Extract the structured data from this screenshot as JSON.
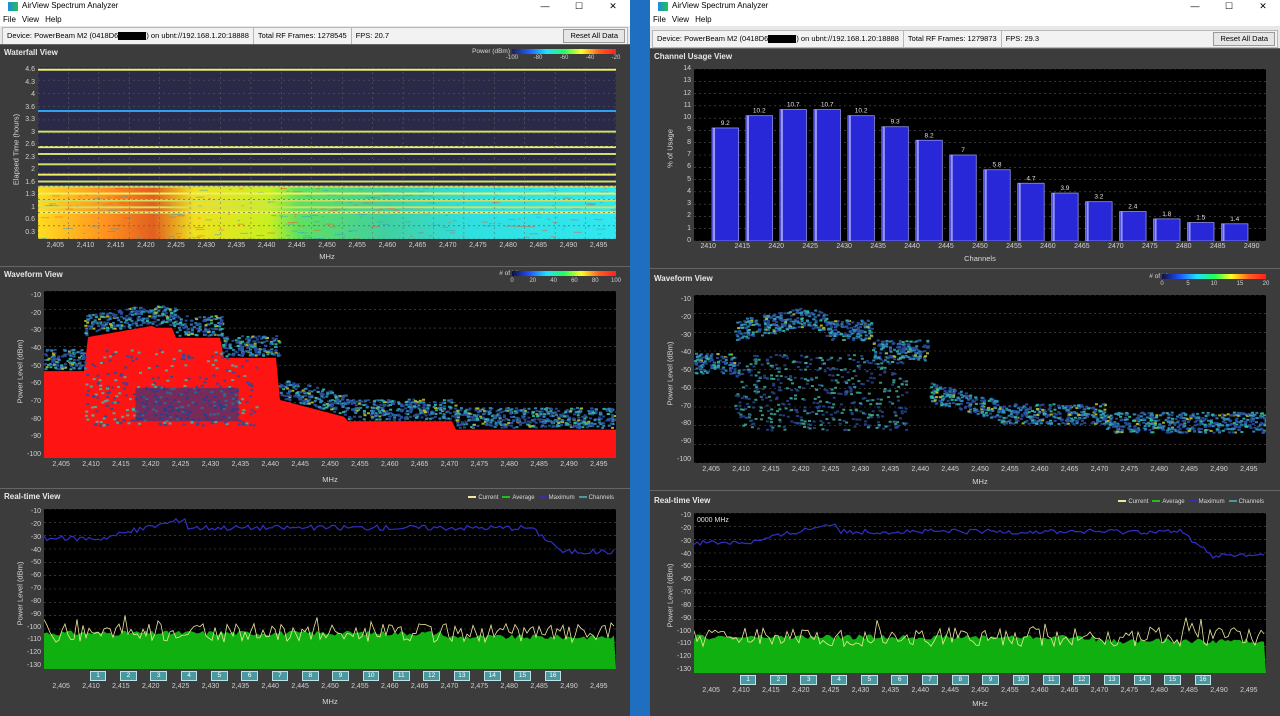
{
  "left": {
    "title": "AirView Spectrum Analyzer",
    "menu": [
      "File",
      "View",
      "Help"
    ],
    "device_prefix": "Device: PowerBeam M2 (0418D6",
    "device_suffix": ") on ubnt://192.168.1.20:18888",
    "rf_frames": "Total RF Frames: 1278545",
    "fps": "FPS: 20.7",
    "reset": "Reset All Data",
    "waterfall": {
      "title": "Waterfall View",
      "ylabel": "Elapsed Time (hours)",
      "xlabel": "MHz",
      "yticks": [
        "4.6",
        "4.3",
        "4",
        "3.6",
        "3.3",
        "3",
        "2.6",
        "2.3",
        "2",
        "1.6",
        "1.3",
        "1",
        "0.6",
        "0.3"
      ],
      "legend_label": "Power (dBm)",
      "legend_ticks": [
        "-100",
        "-80",
        "-60",
        "-40",
        "-20"
      ]
    },
    "waveform": {
      "title": "Waveform View",
      "ylabel": "Power Level (dBm)",
      "xlabel": "MHz",
      "yticks": [
        "-10",
        "-20",
        "-30",
        "-40",
        "-50",
        "-60",
        "-70",
        "-80",
        "-90",
        "-100"
      ],
      "legend_label": "# of hits",
      "legend_ticks": [
        "0",
        "20",
        "40",
        "60",
        "80",
        "100"
      ]
    },
    "realtime": {
      "title": "Real-time View",
      "ylabel": "Power Level (dBm)",
      "xlabel": "MHz",
      "yticks": [
        "-10",
        "-20",
        "-30",
        "-40",
        "-50",
        "-60",
        "-70",
        "-80",
        "-90",
        "-100",
        "-110",
        "-120",
        "-130"
      ],
      "legend": [
        "Current",
        "Average",
        "Maximum",
        "Channels"
      ],
      "channels": [
        "1",
        "2",
        "3",
        "4",
        "5",
        "6",
        "7",
        "8",
        "9",
        "10",
        "11",
        "12",
        "13",
        "14",
        "15",
        "16"
      ]
    },
    "xticks": [
      "2,405",
      "2,410",
      "2,415",
      "2,420",
      "2,425",
      "2,430",
      "2,435",
      "2,440",
      "2,445",
      "2,450",
      "2,455",
      "2,460",
      "2,465",
      "2,470",
      "2,475",
      "2,480",
      "2,485",
      "2,490",
      "2,495"
    ]
  },
  "right": {
    "title": "AirView Spectrum Analyzer",
    "menu": [
      "File",
      "View",
      "Help"
    ],
    "device_prefix": "Device: PowerBeam M2 (0418D6",
    "device_suffix": ") on ubnt://192.168.1.20:18888",
    "rf_frames": "Total RF Frames: 1279873",
    "fps": "FPS: 29.3",
    "reset": "Reset All Data",
    "channel_usage": {
      "title": "Channel Usage View",
      "ylabel": "% of Usage",
      "xlabel": "Channels",
      "yticks": [
        "14",
        "13",
        "12",
        "11",
        "10",
        "9",
        "8",
        "7",
        "6",
        "5",
        "4",
        "3",
        "2",
        "1",
        "0"
      ]
    },
    "waveform": {
      "title": "Waveform View",
      "ylabel": "Power Level (dBm)",
      "xlabel": "MHz",
      "yticks": [
        "-10",
        "-20",
        "-30",
        "-40",
        "-50",
        "-60",
        "-70",
        "-80",
        "-90",
        "-100"
      ],
      "legend_label": "# of hits",
      "legend_ticks": [
        "0",
        "5",
        "10",
        "15",
        "20"
      ]
    },
    "realtime": {
      "title": "Real-time View",
      "ylabel": "Power Level (dBm)",
      "xlabel": "MHz",
      "marker": "0000 MHz",
      "yticks": [
        "-10",
        "-20",
        "-30",
        "-40",
        "-50",
        "-60",
        "-70",
        "-80",
        "-90",
        "-100",
        "-110",
        "-120",
        "-130"
      ],
      "legend": [
        "Current",
        "Average",
        "Maximum",
        "Channels"
      ],
      "channels": [
        "1",
        "2",
        "3",
        "4",
        "5",
        "6",
        "7",
        "8",
        "9",
        "10",
        "11",
        "12",
        "13",
        "14",
        "15",
        "16"
      ]
    },
    "xticks": [
      "2,405",
      "2,410",
      "2,415",
      "2,420",
      "2,425",
      "2,430",
      "2,435",
      "2,440",
      "2,445",
      "2,450",
      "2,455",
      "2,460",
      "2,465",
      "2,470",
      "2,475",
      "2,480",
      "2,485",
      "2,490",
      "2,495"
    ]
  },
  "chart_data": {
    "type": "bar",
    "title": "Channel Usage View",
    "xlabel": "Channels",
    "ylabel": "% of Usage",
    "ylim": [
      0,
      14
    ],
    "categories": [
      "2410",
      "2415",
      "2420",
      "2425",
      "2430",
      "2435",
      "2440",
      "2445",
      "2450",
      "2455",
      "2460",
      "2465",
      "2470",
      "2475",
      "2480",
      "2485"
    ],
    "values": [
      9.2,
      10.2,
      10.7,
      10.7,
      10.2,
      9.3,
      8.2,
      7,
      5.8,
      4.7,
      3.9,
      3.2,
      2.4,
      1.8,
      1.5,
      1.4
    ],
    "x_ticks": [
      "2410",
      "2415",
      "2420",
      "2425",
      "2430",
      "2435",
      "2440",
      "2445",
      "2450",
      "2455",
      "2460",
      "2465",
      "2470",
      "2475",
      "2480",
      "2485",
      "2490"
    ],
    "bar_color": "#2828d8"
  },
  "colors": {
    "current": "#f0e8a0",
    "average": "#20c020",
    "maximum": "#3030b0",
    "channels": "#4a98a0"
  }
}
